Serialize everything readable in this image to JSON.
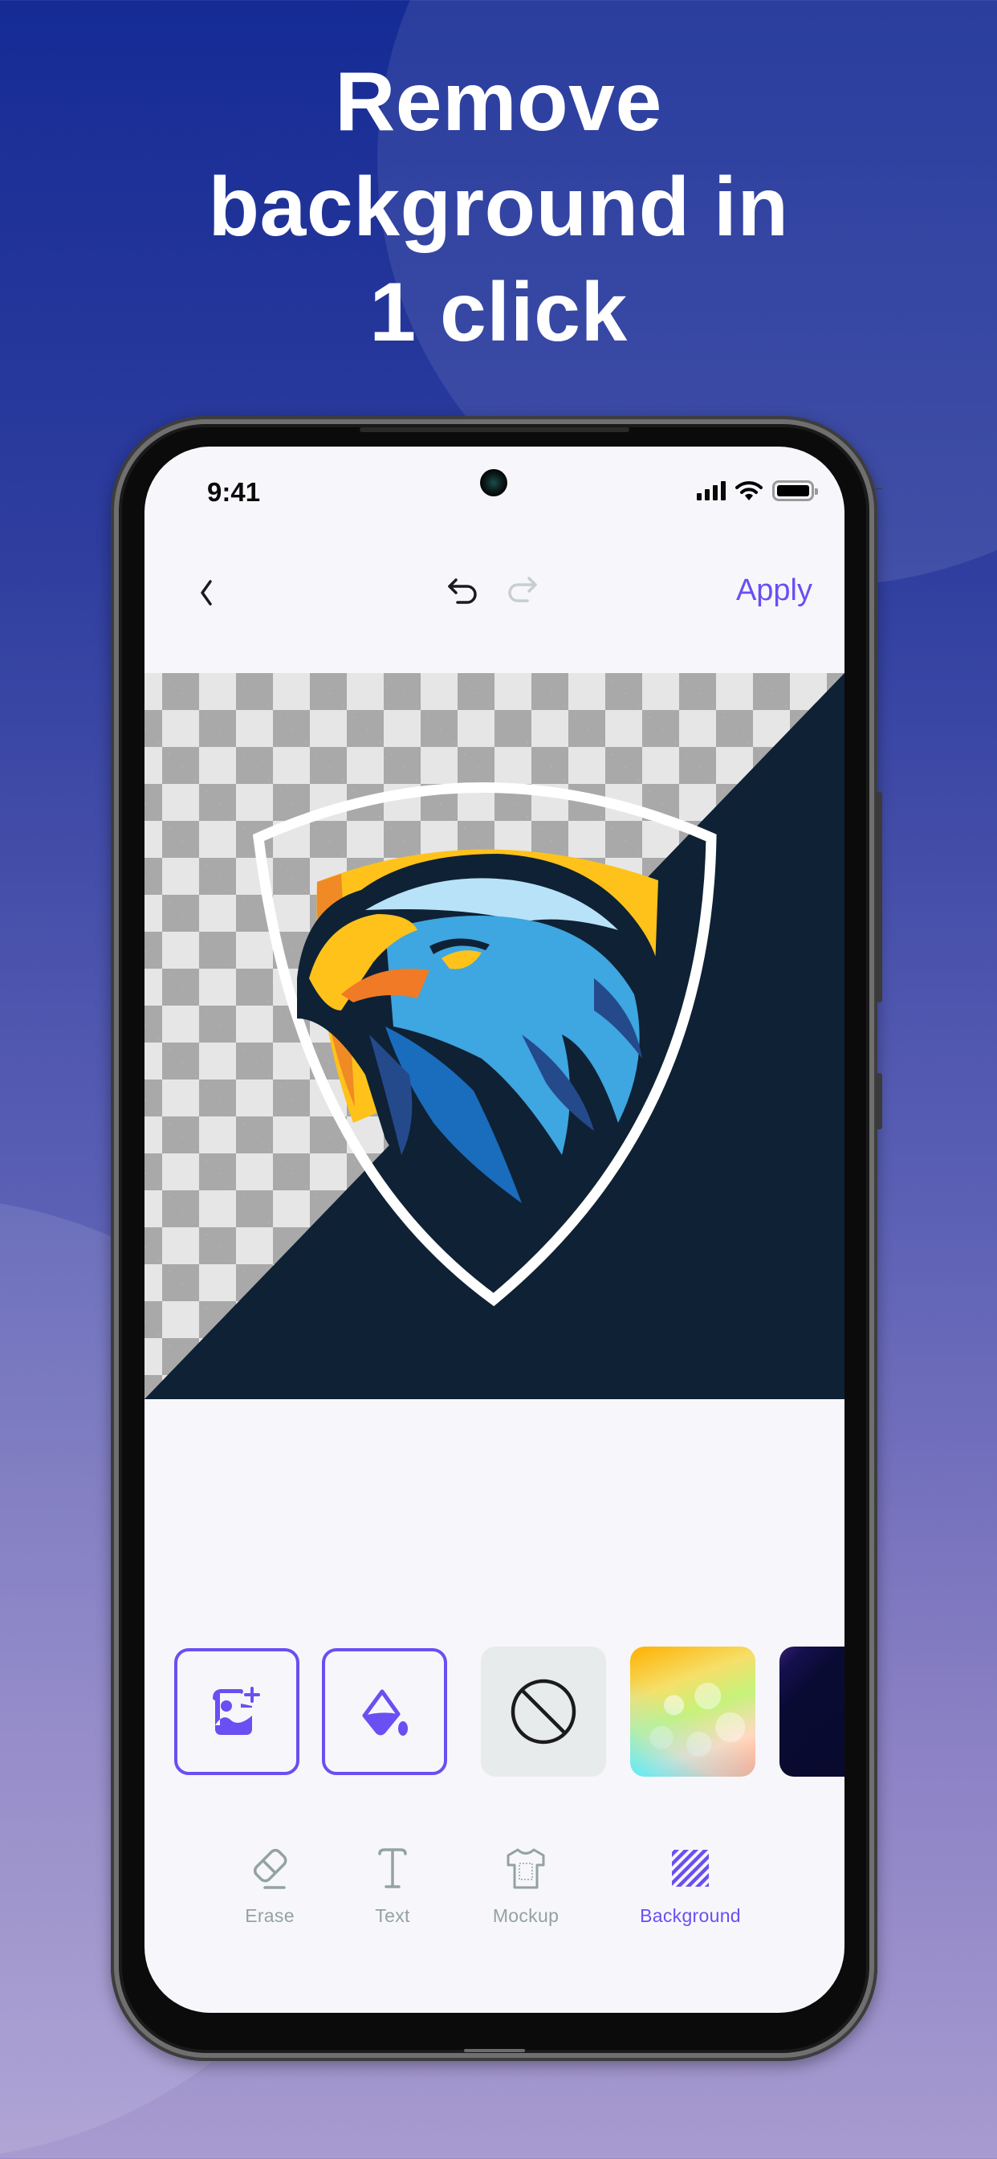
{
  "headline": {
    "lines": [
      "Remove",
      "background in",
      "1 click"
    ]
  },
  "status_bar": {
    "time": "9:41",
    "icons": [
      "signal-icon",
      "wifi-icon",
      "battery-icon"
    ]
  },
  "nav": {
    "back_icon": "chevron-left-icon",
    "undo_icon": "undo-icon",
    "redo_icon": "redo-icon",
    "redo_enabled": false,
    "apply_label": "Apply"
  },
  "canvas": {
    "content": "eagle shield logo",
    "left_half": "transparent checkerboard",
    "right_half_color": "#0f2134"
  },
  "background_options": [
    {
      "type": "add-image",
      "icon": "image-add-icon"
    },
    {
      "type": "color-fill",
      "icon": "paint-bucket-icon"
    },
    {
      "type": "none",
      "icon": "prohibited-icon"
    },
    {
      "type": "gradient-bokeh",
      "icon": "bokeh-swatch"
    },
    {
      "type": "dark-preset",
      "icon": "dark-swatch"
    }
  ],
  "tabs": [
    {
      "label": "Erase",
      "icon": "eraser-icon",
      "active": false
    },
    {
      "label": "Text",
      "icon": "text-icon",
      "active": false
    },
    {
      "label": "Mockup",
      "icon": "tshirt-icon",
      "active": false
    },
    {
      "label": "Background",
      "icon": "background-hatch-icon",
      "active": true
    }
  ],
  "colors": {
    "accent": "#6a4ff2",
    "inactive": "#93a3a0",
    "screen_bg": "#f7f7fb"
  }
}
